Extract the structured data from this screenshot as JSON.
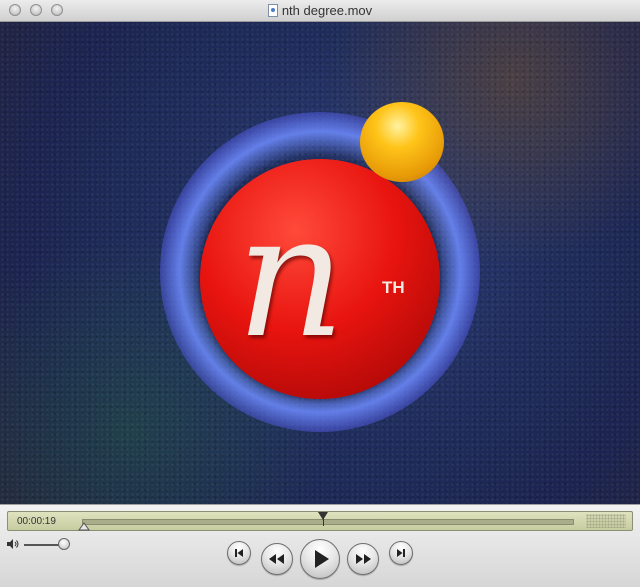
{
  "window": {
    "title": "nth degree.mov",
    "icons": {
      "document": "movie-file-icon"
    }
  },
  "video": {
    "logo_letter": "n",
    "logo_superscript": "TH"
  },
  "controls": {
    "time_display": "00:00:19",
    "playback_position": 0.49,
    "volume_level": 1.0,
    "buttons": [
      "skip-to-start-icon",
      "rewind-icon",
      "play-icon",
      "fast-forward-icon",
      "skip-to-end-icon"
    ]
  }
}
